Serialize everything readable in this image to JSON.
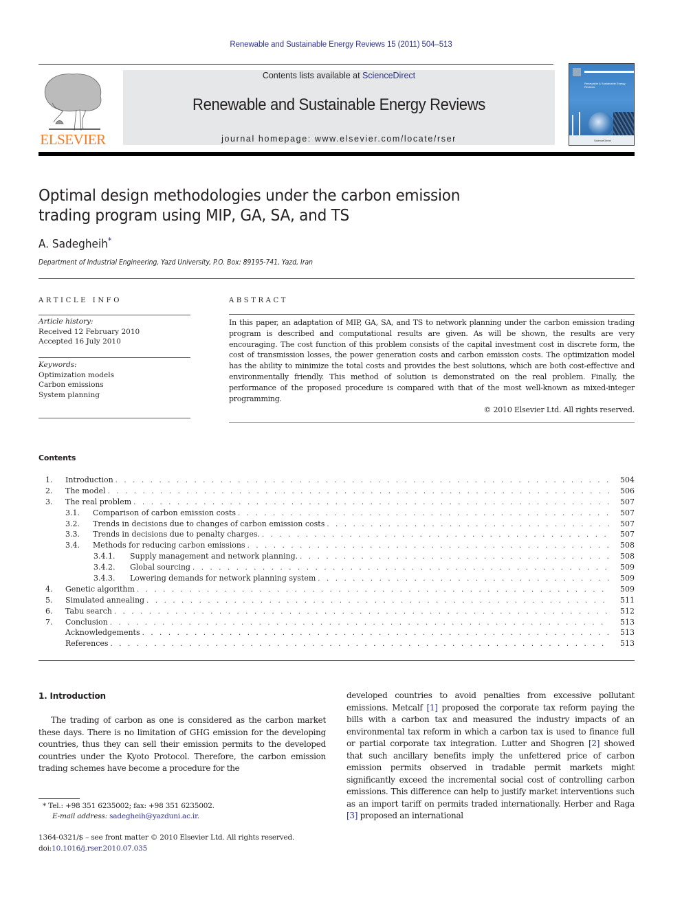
{
  "running_header": {
    "citation": "Renewable and Sustainable Energy Reviews 15 (2011) 504–513"
  },
  "masthead": {
    "publisher_logo_word": "ELSEVIER",
    "contents_prefix": "Contents lists available at ",
    "contents_link": "ScienceDirect",
    "journal_title": "Renewable and Sustainable Energy Reviews",
    "homepage_prefix": "journal homepage: ",
    "homepage_url": "www.elsevier.com/locate/rser",
    "cover_title": "Renewable & Sustainable Energy Reviews",
    "cover_footer": "ScienceDirect"
  },
  "article": {
    "title_line1": "Optimal design methodologies under the carbon emission",
    "title_line2": "trading program using MIP, GA, SA, and TS",
    "author": "A. Sadegheih",
    "author_mark": "*",
    "affiliation": "Department of Industrial Engineering, Yazd University, P.O. Box: 89195-741, Yazd, Iran"
  },
  "article_info": {
    "label": "ARTICLE INFO",
    "history_label": "Article history:",
    "received": "Received 12 February 2010",
    "accepted": "Accepted 16 July 2010",
    "keywords_label": "Keywords:",
    "keywords": [
      "Optimization models",
      "Carbon emissions",
      "System planning"
    ]
  },
  "abstract": {
    "label": "ABSTRACT",
    "text": "In this paper, an adaptation of MIP, GA, SA, and TS to network planning under the carbon emission trading program is described and computational results are given. As will be shown, the results are very encouraging. The cost function of this problem consists of the capital investment cost in discrete form, the cost of transmission losses, the power generation costs and carbon emission costs. The optimization model has the ability to minimize the total costs and provides the best solutions, which are both cost-effective and environmentally friendly. This method of solution is demonstrated on the real problem. Finally, the performance of the proposed procedure is compared with that of the most well-known as mixed-integer programming.",
    "copyright": "© 2010 Elsevier Ltd. All rights reserved."
  },
  "contents": {
    "heading": "Contents",
    "items": [
      {
        "num": "1.",
        "title": "Introduction",
        "page": "504"
      },
      {
        "num": "2.",
        "title": "The model",
        "page": "506"
      },
      {
        "num": "3.",
        "title": "The real problem",
        "page": "507"
      },
      {
        "num": "3.1.",
        "title": "Comparison of carbon emission costs",
        "page": "507"
      },
      {
        "num": "3.2.",
        "title": "Trends in decisions due to changes of carbon emission costs",
        "page": "507"
      },
      {
        "num": "3.3.",
        "title": "Trends in decisions due to penalty charges.",
        "page": "507"
      },
      {
        "num": "3.4.",
        "title": "Methods for reducing carbon emissions",
        "page": "508"
      },
      {
        "num": "3.4.1.",
        "title": "Supply management and network planning.",
        "page": "508"
      },
      {
        "num": "3.4.2.",
        "title": "Global sourcing",
        "page": "509"
      },
      {
        "num": "3.4.3.",
        "title": "Lowering demands for network planning system",
        "page": "509"
      },
      {
        "num": "4.",
        "title": "Genetic algorithm",
        "page": "509"
      },
      {
        "num": "5.",
        "title": "Simulated annealing",
        "page": "511"
      },
      {
        "num": "6.",
        "title": "Tabu search",
        "page": "512"
      },
      {
        "num": "7.",
        "title": "Conclusion",
        "page": "513"
      },
      {
        "num": "",
        "title": "Acknowledgements",
        "page": "513"
      },
      {
        "num": "",
        "title": "References",
        "page": "513"
      }
    ]
  },
  "body": {
    "intro_heading": "1.  Introduction",
    "left_column": "The trading of carbon as one is considered as the carbon market these days. There is no limitation of GHG emission for the developing countries, thus they can sell their emission permits to the developed countries under the Kyoto Protocol. Therefore, the carbon emission trading schemes have become a procedure for the",
    "right_col": {
      "p1": "developed countries to avoid penalties from excessive pollutant emissions. Metcalf ",
      "ref1": "[1]",
      "p2": " proposed the corporate tax reform paying the bills with a carbon tax and measured the industry impacts of an environmental tax reform in which a carbon tax is used to finance full or partial corporate tax integration. Lutter and Shogren ",
      "ref2": "[2]",
      "p3": " showed that such ancillary benefits imply the unfettered price of carbon emission permits observed in tradable permit markets might significantly exceed the incremental social cost of controlling carbon emissions. This difference can help to justify market interventions such as an import tariff on permits traded internationally. Herber and Raga ",
      "ref3": "[3]",
      "p4": " proposed an international"
    }
  },
  "footnote": {
    "mark": "*",
    "contact": " Tel.: +98 351 6235002; fax: +98 351 6235002.",
    "email_label": "E-mail address: ",
    "email": "sadegheih@yazduni.ac.ir",
    "email_end": "."
  },
  "front_matter": {
    "issn_line": "1364-0321/$ – see front matter © 2010 Elsevier Ltd. All rights reserved.",
    "doi_prefix": "doi:",
    "doi": "10.1016/j.rser.2010.07.035"
  },
  "colors": {
    "link_blue": "#2e3192",
    "elsevier_orange": "#f47920",
    "band_gray": "#e6e7e8"
  }
}
